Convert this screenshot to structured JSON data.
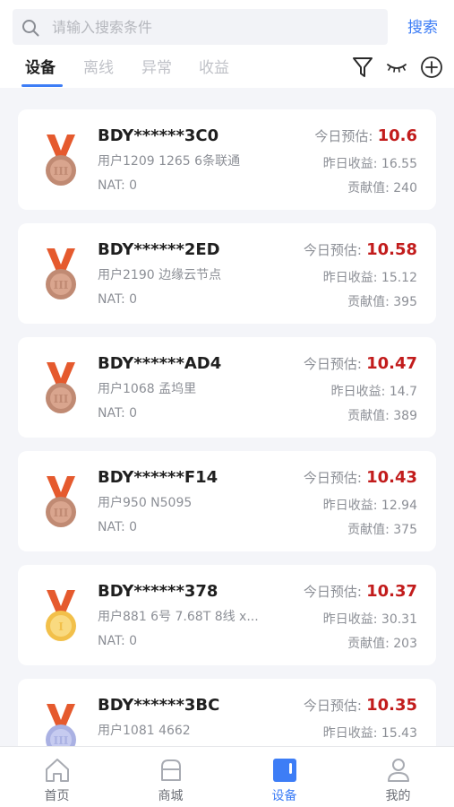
{
  "search": {
    "placeholder": "请输入搜索条件",
    "value": "",
    "button_label": "搜索"
  },
  "tabs": [
    {
      "label": "设备",
      "active": true
    },
    {
      "label": "离线",
      "active": false
    },
    {
      "label": "异常",
      "active": false
    },
    {
      "label": "收益",
      "active": false
    }
  ],
  "toolbar_icons": [
    "filter-icon",
    "eye-closed-icon",
    "add-circle-icon"
  ],
  "labels": {
    "today_estimate": "今日预估:",
    "yesterday_income": "昨日收益:",
    "contribution": "贡献值:",
    "nat": "NAT:"
  },
  "devices": [
    {
      "name": "BDY******3C0",
      "user": "用户1209  1265 6条联通",
      "nat": "0",
      "today": "10.6",
      "yesterday": "16.55",
      "contribution": "240",
      "medal": "bronze"
    },
    {
      "name": "BDY******2ED",
      "user": "用户2190  边缘云节点",
      "nat": "0",
      "today": "10.58",
      "yesterday": "15.12",
      "contribution": "395",
      "medal": "bronze"
    },
    {
      "name": "BDY******AD4",
      "user": "用户1068  孟坞里",
      "nat": "0",
      "today": "10.47",
      "yesterday": "14.7",
      "contribution": "389",
      "medal": "bronze"
    },
    {
      "name": "BDY******F14",
      "user": "用户950  N5095",
      "nat": "0",
      "today": "10.43",
      "yesterday": "12.94",
      "contribution": "375",
      "medal": "bronze"
    },
    {
      "name": "BDY******378",
      "user": "用户881  6号 7.68T 8线 x...",
      "nat": "0",
      "today": "10.37",
      "yesterday": "30.31",
      "contribution": "203",
      "medal": "gold"
    },
    {
      "name": "BDY******3BC",
      "user": "用户1081  4662",
      "nat": "",
      "today": "10.35",
      "yesterday": "15.43",
      "contribution": "",
      "medal": "silver"
    }
  ],
  "bottom_nav": [
    {
      "label": "首页",
      "icon": "home-icon",
      "active": false
    },
    {
      "label": "商城",
      "icon": "shop-icon",
      "active": false
    },
    {
      "label": "设备",
      "icon": "device-icon",
      "active": true
    },
    {
      "label": "我的",
      "icon": "user-icon",
      "active": false
    }
  ],
  "colors": {
    "accent": "#3d7df6",
    "value_red": "#c21c1c",
    "bronze": "#c08a73",
    "gold": "#f2c04a",
    "silver": "#aab1e3",
    "ribbon": "#e55a2e"
  }
}
